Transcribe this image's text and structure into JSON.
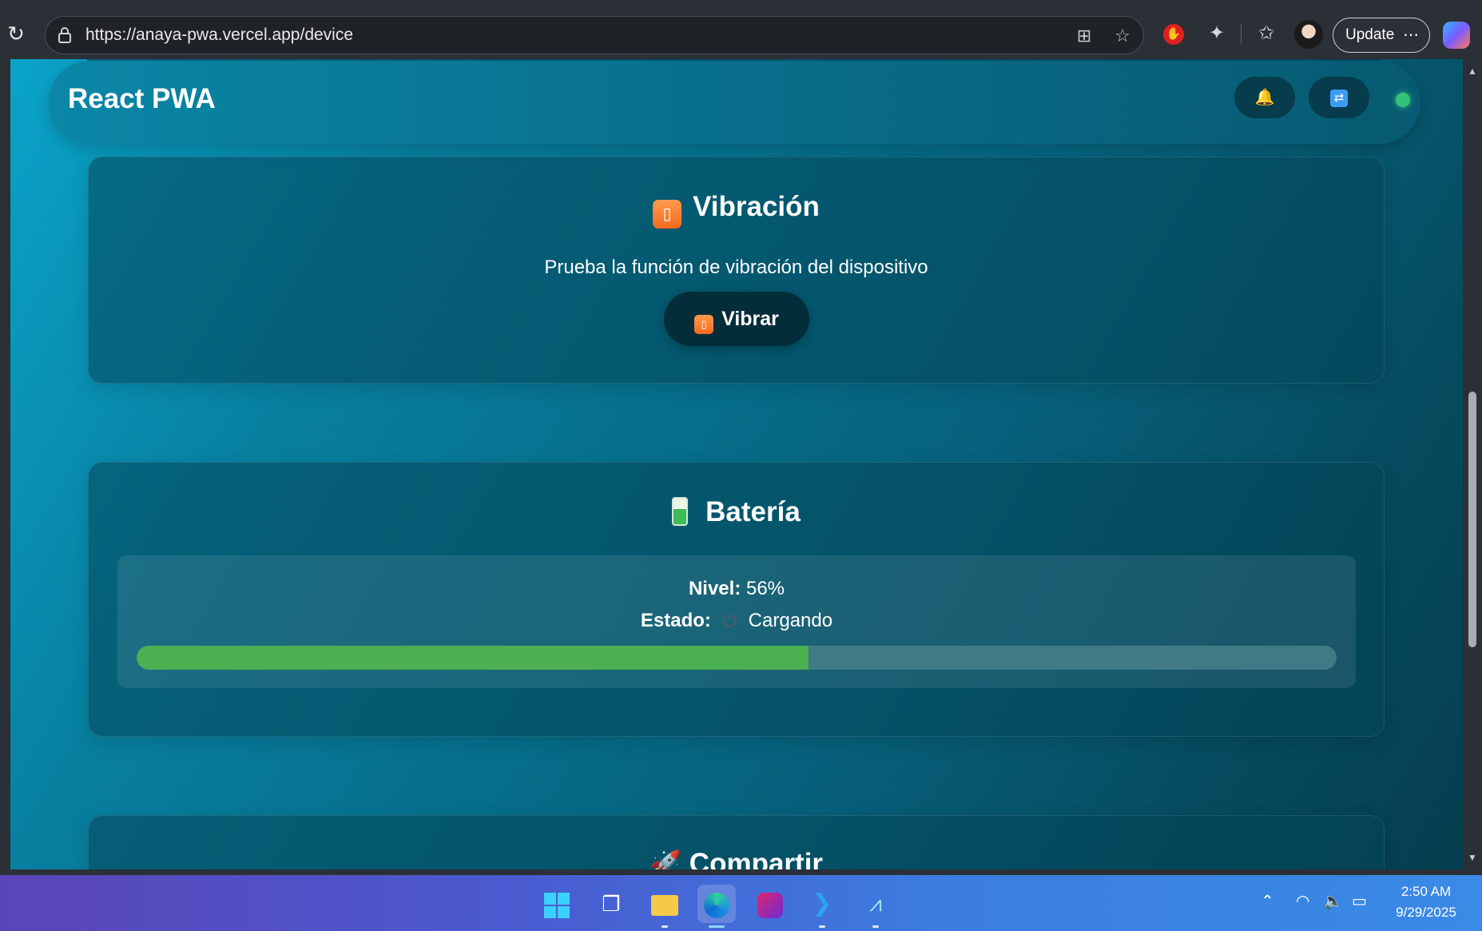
{
  "browser": {
    "url": "https://anaya-pwa.vercel.app/device",
    "update_label": "Update",
    "more_label": "⋯"
  },
  "app": {
    "title": "React PWA"
  },
  "vibration": {
    "icon": "vibration-mode-icon",
    "title": "Vibración",
    "description": "Prueba la función de vibración del dispositivo",
    "button_label": "Vibrar"
  },
  "battery": {
    "icon": "battery-icon",
    "title": "Batería",
    "level_label": "Nivel:",
    "level_value": "56%",
    "level_fraction": 0.56,
    "status_label": "Estado:",
    "status_value": "Cargando",
    "status_icon": "electric-plug-icon",
    "bar_color": "#4caf50"
  },
  "share": {
    "icon": "rocket-icon",
    "title": "Compartir"
  },
  "taskbar": {
    "time": "2:50 AM",
    "date": "9/29/2025"
  }
}
